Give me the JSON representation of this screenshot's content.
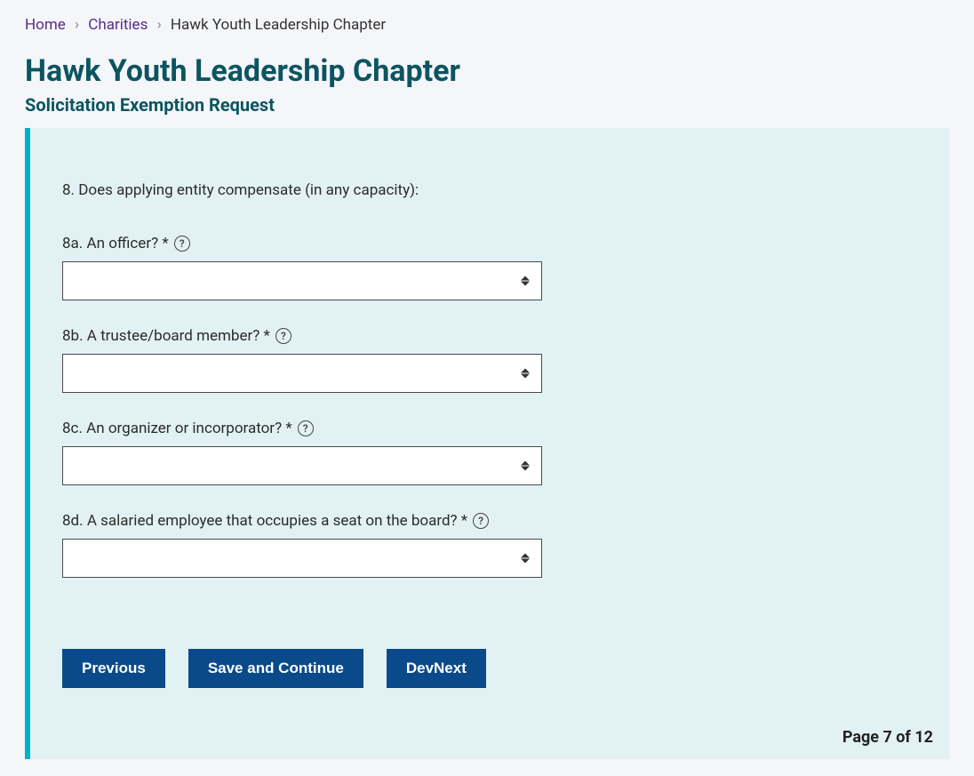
{
  "breadcrumb": {
    "home": "Home",
    "charities": "Charities",
    "current": "Hawk Youth Leadership Chapter"
  },
  "header": {
    "title": "Hawk Youth Leadership Chapter",
    "subtitle": "Solicitation Exemption Request"
  },
  "form": {
    "question8_heading": "8. Does applying entity compensate (in any capacity):",
    "q8a": {
      "label": "8a. An officer? *",
      "value": ""
    },
    "q8b": {
      "label": "8b. A trustee/board member? *",
      "value": ""
    },
    "q8c": {
      "label": "8c. An organizer or incorporator? *",
      "value": ""
    },
    "q8d": {
      "label": "8d. A salaried employee that occupies a seat on the board? *",
      "value": ""
    }
  },
  "buttons": {
    "previous": "Previous",
    "save_continue": "Save and Continue",
    "devnext": "DevNext"
  },
  "pager": {
    "text": "Page 7 of 12"
  },
  "icons": {
    "help_glyph": "?"
  }
}
